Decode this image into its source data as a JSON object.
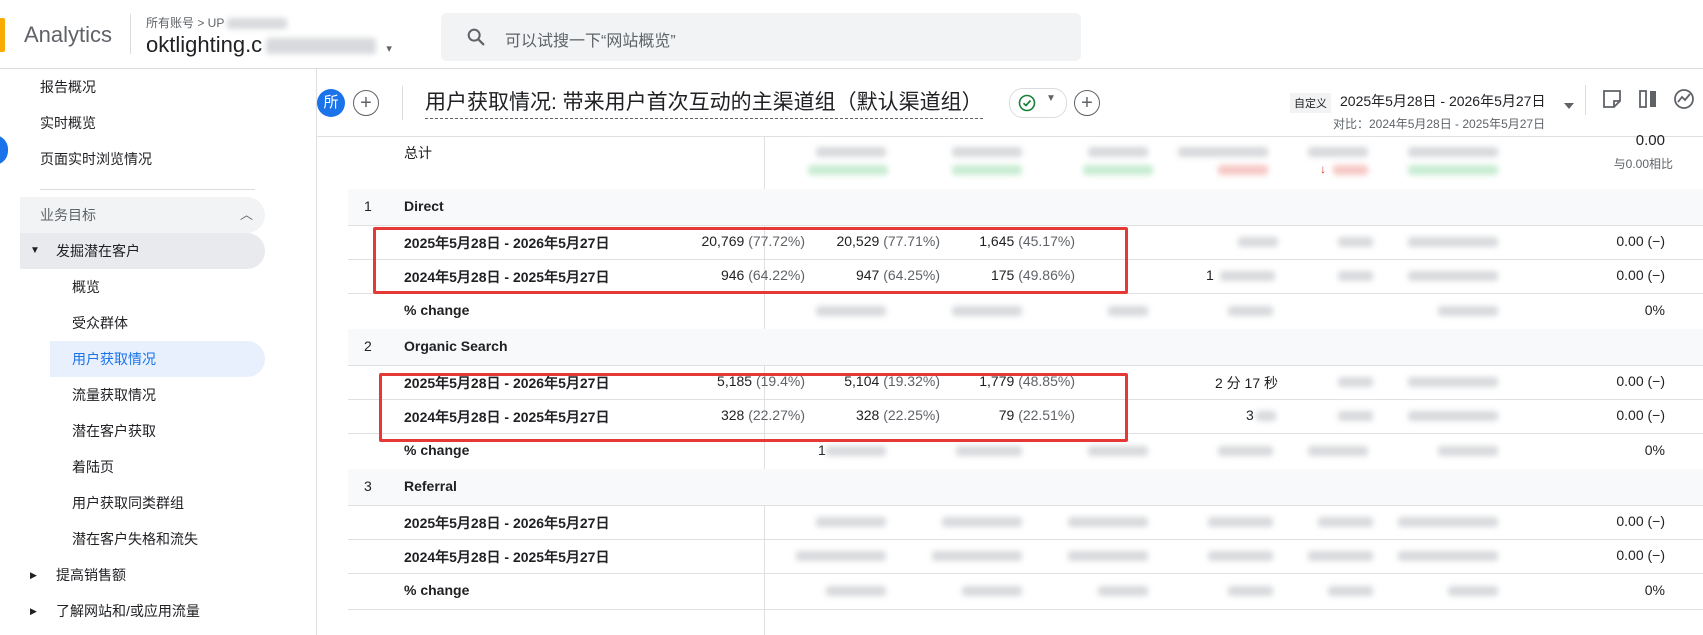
{
  "app": {
    "brand": "Analytics",
    "breadcrumb": "所有账号 > UP",
    "account": "oktlighting.c"
  },
  "search": {
    "placeholder": "可以试搜一下“网站概览”"
  },
  "sidebar": {
    "items": [
      {
        "label": "报告概况"
      },
      {
        "label": "实时概览"
      },
      {
        "label": "页面实时浏览情况"
      }
    ],
    "section_label": "业务目标",
    "group_label": "发掘潜在客户",
    "sub_items": [
      {
        "label": "概览"
      },
      {
        "label": "受众群体"
      },
      {
        "label": "用户获取情况"
      },
      {
        "label": "流量获取情况"
      },
      {
        "label": "潜在客户获取"
      },
      {
        "label": "着陆页"
      },
      {
        "label": "用户获取同类群组"
      },
      {
        "label": "潜在客户失格和流失"
      }
    ],
    "collapsed": [
      {
        "label": "提高销售额"
      },
      {
        "label": "了解网站和/或应用流量"
      }
    ]
  },
  "header": {
    "avatar": "所",
    "title": "用户获取情况: 带来用户首次互动的主渠道组（默认渠道组）",
    "date_badge": "自定义",
    "date_range": "2025年5月28日 - 2026年5月27日",
    "compare": "对比：2024年5月28日 - 2025年5月27日"
  },
  "table": {
    "total": {
      "label": "总计",
      "last_value": "0.00",
      "last_sub": "与0.00相比"
    },
    "groups": [
      {
        "index": "1",
        "name": "Direct",
        "rows": [
          {
            "label": "2025年5月28日 - 2026年5月27日",
            "c1": "20,769",
            "c1p": "(77.72%)",
            "c2": "20,529",
            "c2p": "(77.71%)",
            "c3": "1,645",
            "c3p": "(45.17%)",
            "c4": "",
            "last": "0.00 (−)"
          },
          {
            "label": "2024年5月28日 - 2025年5月27日",
            "c1": "946",
            "c1p": "(64.22%)",
            "c2": "947",
            "c2p": "(64.25%)",
            "c3": "175",
            "c3p": "(49.86%)",
            "c4": "1",
            "last": "0.00 (−)"
          },
          {
            "label": "% change",
            "c1": "",
            "c1p": "",
            "c2": "",
            "c2p": "",
            "c3": "",
            "c3p": "",
            "c4": "",
            "last": "0%"
          }
        ]
      },
      {
        "index": "2",
        "name": "Organic Search",
        "rows": [
          {
            "label": "2025年5月28日 - 2026年5月27日",
            "c1": "5,185",
            "c1p": "(19.4%)",
            "c2": "5,104",
            "c2p": "(19.32%)",
            "c3": "1,779",
            "c3p": "(48.85%)",
            "c4": "2 分 17 秒",
            "last": "0.00 (−)"
          },
          {
            "label": "2024年5月28日 - 2025年5月27日",
            "c1": "328",
            "c1p": "(22.27%)",
            "c2": "328",
            "c2p": "(22.25%)",
            "c3": "79",
            "c3p": "(22.51%)",
            "c4": "3",
            "last": "0.00 (−)"
          },
          {
            "label": "% change",
            "c1": "1",
            "c1p": "",
            "c2": "",
            "c2p": "",
            "c3": "",
            "c3p": "",
            "c4": "",
            "last": "0%"
          }
        ]
      },
      {
        "index": "3",
        "name": "Referral",
        "rows": [
          {
            "label": "2025年5月28日 - 2026年5月27日",
            "c1": "",
            "c1p": "",
            "c2": "",
            "c2p": "",
            "c3": "",
            "c3p": "",
            "c4": "",
            "last": "0.00 (−)"
          },
          {
            "label": "2024年5月28日 - 2025年5月27日",
            "c1": "",
            "c1p": "",
            "c2": "",
            "c2p": "",
            "c3": "",
            "c3p": "",
            "c4": "",
            "last": "0.00 (−)"
          },
          {
            "label": "% change",
            "c1": "",
            "c1p": "",
            "c2": "",
            "c2p": "",
            "c3": "",
            "c3p": "",
            "c4": "",
            "last": "0%"
          }
        ]
      }
    ]
  },
  "colors": {
    "accent": "#1a73e8",
    "highlight": "#e53935",
    "brand": "#f9ab00"
  }
}
